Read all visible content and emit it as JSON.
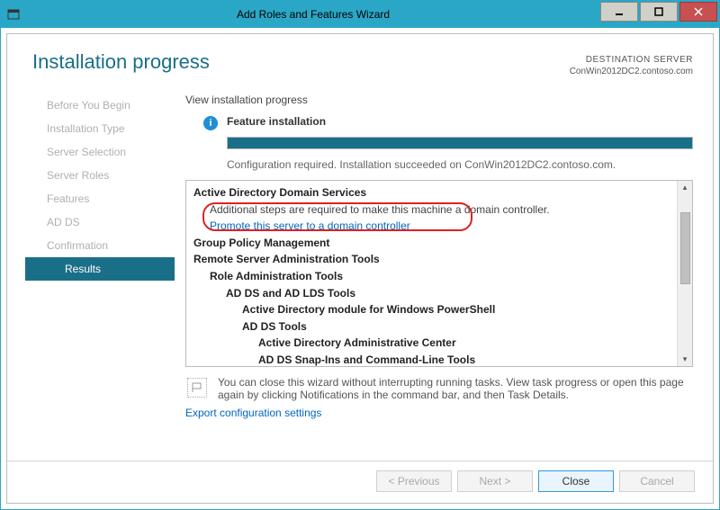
{
  "window": {
    "title": "Add Roles and Features Wizard"
  },
  "header": {
    "title": "Installation progress",
    "dest_label": "DESTINATION SERVER",
    "dest_value": "ConWin2012DC2.contoso.com"
  },
  "sidebar": {
    "steps": [
      "Before You Begin",
      "Installation Type",
      "Server Selection",
      "Server Roles",
      "Features",
      "AD DS",
      "Confirmation",
      "Results"
    ],
    "active_index": 7
  },
  "content": {
    "top_label": "View installation progress",
    "status_title": "Feature installation",
    "status_msg": "Configuration required. Installation succeeded on ConWin2012DC2.contoso.com.",
    "progress_pct": 100,
    "tree": {
      "l1": "Active Directory Domain Services",
      "l1_note": "Additional steps are required to make this machine a domain controller.",
      "l1_link": "Promote this server to a domain controller",
      "l2": "Group Policy Management",
      "l3": "Remote Server Administration Tools",
      "l3_1": "Role Administration Tools",
      "l3_1_1": "AD DS and AD LDS Tools",
      "l3_1_1_1": "Active Directory module for Windows PowerShell",
      "l3_1_1_2": "AD DS Tools",
      "l3_1_1_2_1": "Active Directory Administrative Center",
      "l3_1_1_2_2": "AD DS Snap-Ins and Command-Line Tools"
    },
    "footer_note": "You can close this wizard without interrupting running tasks. View task progress or open this page again by clicking Notifications in the command bar, and then Task Details.",
    "export_link": "Export configuration settings"
  },
  "buttons": {
    "previous": "< Previous",
    "next": "Next >",
    "close": "Close",
    "cancel": "Cancel"
  }
}
